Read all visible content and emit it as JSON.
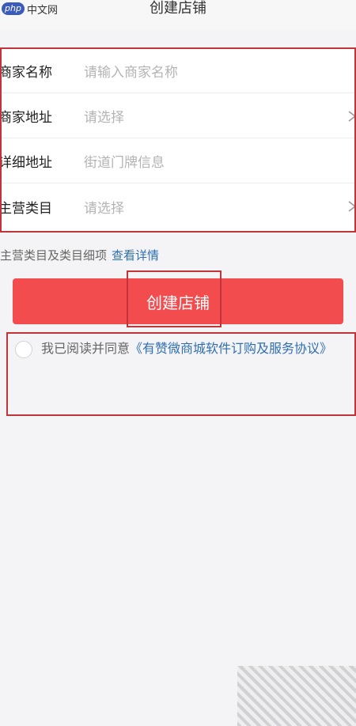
{
  "header": {
    "logo_badge": "php",
    "logo_text": "中文网",
    "title": "创建店铺"
  },
  "form": {
    "rows": [
      {
        "label": "商家名称",
        "placeholder": "请输入商家名称",
        "has_arrow": false
      },
      {
        "label": "商家地址",
        "placeholder": "请选择",
        "has_arrow": true
      },
      {
        "label": "详细地址",
        "placeholder": "街道门牌信息",
        "has_arrow": false
      },
      {
        "label": "主营类目",
        "placeholder": "请选择",
        "has_arrow": true
      }
    ]
  },
  "hint": {
    "text": "主营类目及类目细项",
    "link": "查看详情"
  },
  "create_button": {
    "label": "创建店铺"
  },
  "agreement": {
    "prefix": "我已阅读并同意",
    "link": "《有赞微商城软件订购及服务协议》"
  },
  "colors": {
    "button": "#f24c4f",
    "link": "#2f6fb2",
    "annotation": "#c0343a"
  }
}
